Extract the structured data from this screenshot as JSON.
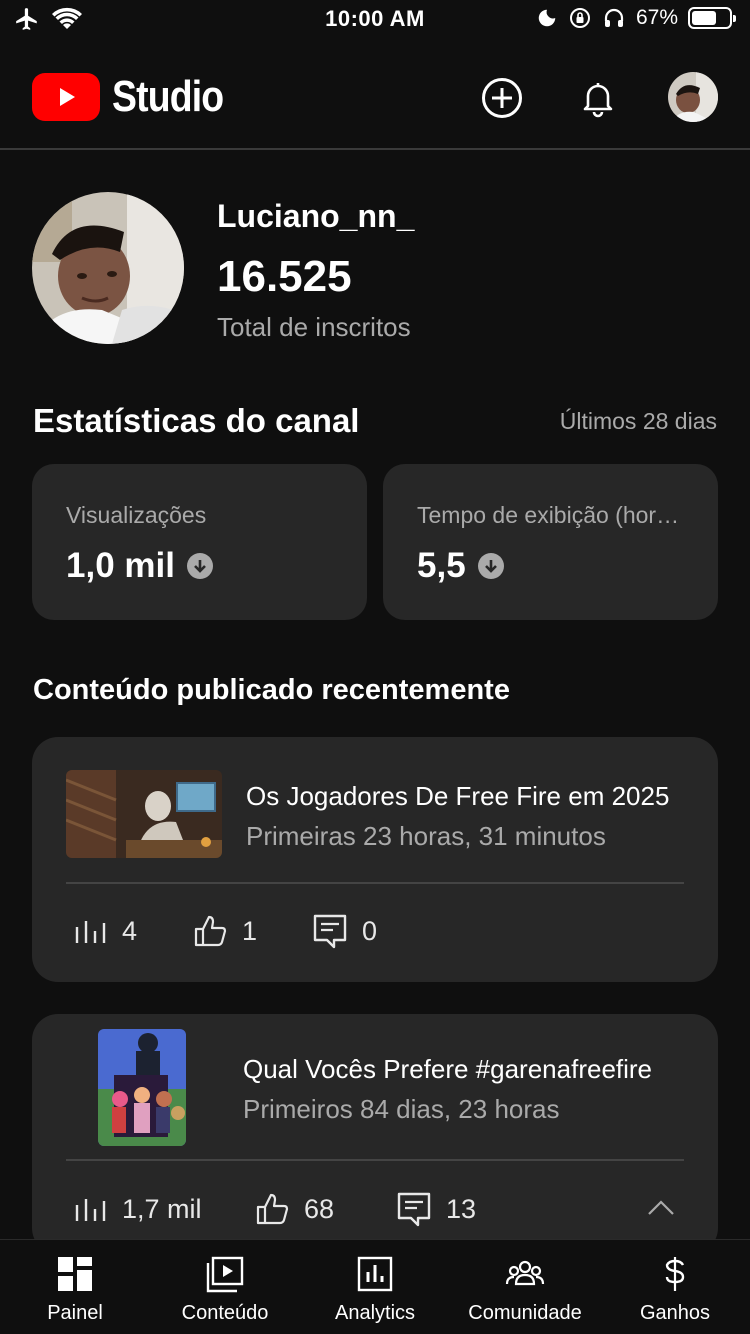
{
  "status_bar": {
    "time": "10:00 AM",
    "battery": "67%",
    "battery_level": 0.67
  },
  "header": {
    "logo_text": "Studio",
    "icons": [
      "create-icon",
      "notifications-bell-icon",
      "account-avatar"
    ]
  },
  "channel": {
    "name": "Luciano_nn_",
    "subscribers": "16.525",
    "subscribers_label": "Total de inscritos"
  },
  "stats": {
    "title": "Estatísticas do canal",
    "period": "Últimos 28 dias",
    "cards": [
      {
        "label": "Visualizações",
        "value": "1,0 mil",
        "trend": "down"
      },
      {
        "label": "Tempo de exibição (horas)",
        "value": "5,5",
        "trend": "down"
      }
    ]
  },
  "recent": {
    "title": "Conteúdo publicado recentemente",
    "videos": [
      {
        "title": "Os Jogadores De Free Fire em 2025",
        "meta": "Primeiras 23 horas, 31 minutos",
        "views": "4",
        "likes": "1",
        "comments": "0"
      },
      {
        "title": "Qual Vocês Prefere #garenafreefire",
        "meta": "Primeiros 84 dias, 23 horas",
        "views": "1,7 mil",
        "likes": "68",
        "comments": "13"
      }
    ]
  },
  "nav": {
    "items": [
      {
        "label": "Painel",
        "icon": "dashboard-icon"
      },
      {
        "label": "Conteúdo",
        "icon": "content-icon"
      },
      {
        "label": "Analytics",
        "icon": "analytics-icon"
      },
      {
        "label": "Comunidade",
        "icon": "community-icon"
      },
      {
        "label": "Ganhos",
        "icon": "earnings-icon"
      }
    ]
  },
  "colors": {
    "background": "#0f0f0f",
    "card": "#272727",
    "brand_red": "#ff0000",
    "secondary_text": "#aaaaaa"
  }
}
